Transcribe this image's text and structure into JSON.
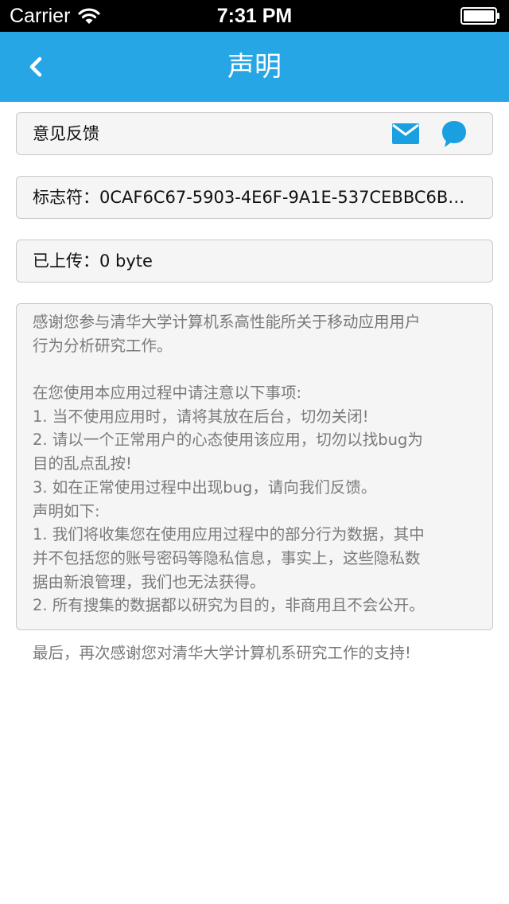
{
  "status_bar": {
    "carrier": "Carrier",
    "time": "7:31 PM"
  },
  "nav": {
    "title": "声明",
    "back_icon": "chevron-left-icon",
    "color": "#26a6e4"
  },
  "feedback": {
    "label": "意见反馈",
    "mail_icon": "mail-icon",
    "chat_icon": "chat-bubble-icon",
    "icon_color": "#1aa0e0"
  },
  "identifier": {
    "text": "标志符：0CAF6C67-5903-4E6F-9A1E-537CEBBC6B…"
  },
  "uploaded": {
    "text": "已上传：0 byte"
  },
  "statement": {
    "lines": [
      "感谢您参与清华大学计算机系高性能所关于移动应用用户",
      "行为分析研究工作。",
      "",
      "在您使用本应用过程中请注意以下事项:",
      "1. 当不使用应用时，请将其放在后台，切勿关闭!",
      "2. 请以一个正常用户的心态使用该应用，切勿以找bug为",
      "目的乱点乱按!",
      "3. 如在正常使用过程中出现bug，请向我们反馈。",
      "声明如下:",
      "1. 我们将收集您在使用应用过程中的部分行为数据，其中",
      "并不包括您的账号密码等隐私信息，事实上，这些隐私数",
      "据由新浪管理，我们也无法获得。",
      "2. 所有搜集的数据都以研究为目的，非商用且不会公开。",
      "",
      "最后，再次感谢您对清华大学计算机系研究工作的支持!"
    ]
  }
}
